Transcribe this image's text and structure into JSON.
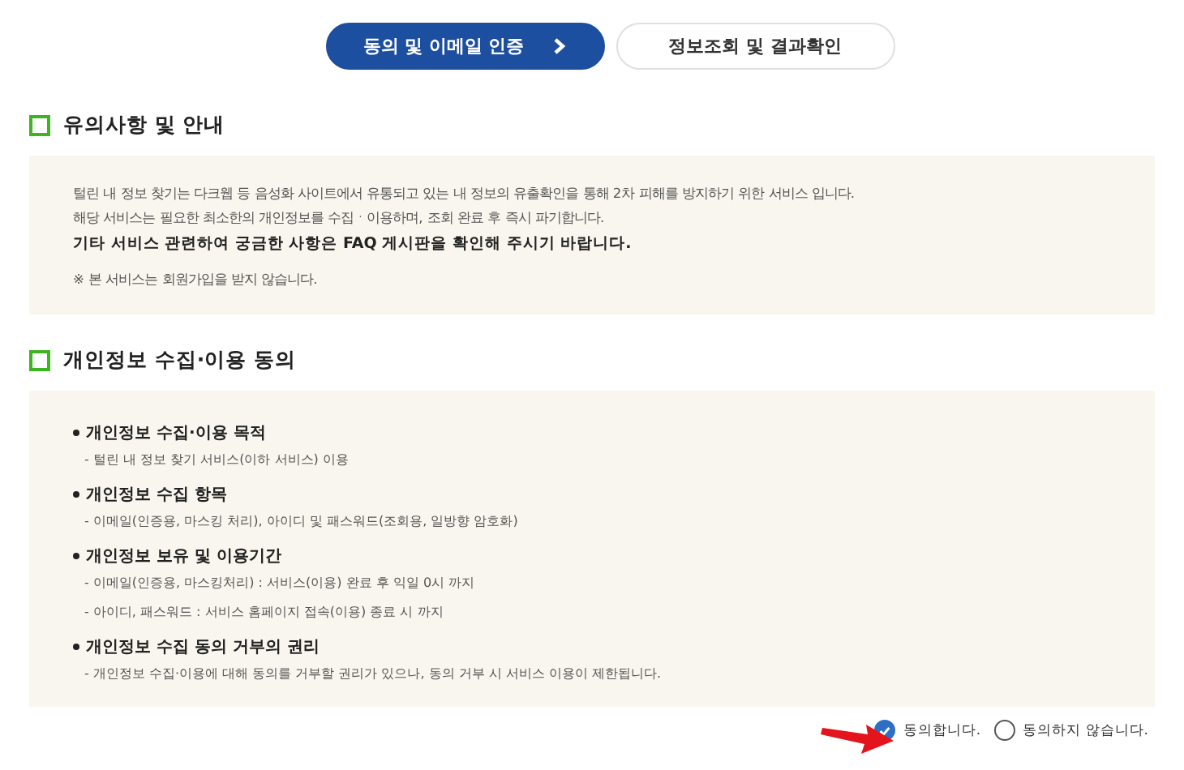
{
  "steps": [
    {
      "label": "동의 및 이메일 인증",
      "selected": true
    },
    {
      "label": "정보조회 및 결과확인",
      "selected": false
    }
  ],
  "notice": {
    "title": "유의사항 및 안내",
    "lines": [
      {
        "text": "털린 내 정보 찾기는 다크웹 등 음성화 사이트에서 유통되고 있는 내 정보의 유출확인을 통해 2차 피해를 방지하기 위한 서비스 입니다.",
        "kind": "plain"
      },
      {
        "text": "해당 서비스는 필요한 최소한의 개인정보를 수집ㆍ이용하며, 조회 완료 후 즉시 파기합니다.",
        "kind": "plain"
      },
      {
        "text": "기타 서비스 관련하여 궁금한 사항은 FAQ 게시판을 확인해 주시기 바랍니다.",
        "kind": "strong"
      },
      {
        "text": "※ 본 서비스는 회원가입을 받지 않습니다.",
        "kind": "note"
      }
    ]
  },
  "consent": {
    "title": "개인정보 수집·이용 동의",
    "items": [
      {
        "heading": "개인정보 수집·이용 목적",
        "details": [
          "- 털린 내 정보 찾기 서비스(이하 서비스) 이용"
        ]
      },
      {
        "heading": "개인정보 수집 항목",
        "details": [
          "- 이메일(인증용, 마스킹 처리), 아이디 및 패스워드(조회용, 일방향 암호화)"
        ]
      },
      {
        "heading": "개인정보 보유 및 이용기간",
        "details": [
          "- 이메일(인증용, 마스킹처리) : 서비스(이용) 완료 후 익일 0시 까지",
          "- 아이디, 패스워드 : 서비스 홈페이지 접속(이용) 종료 시 까지"
        ]
      },
      {
        "heading": "개인정보 수집 동의 거부의 권리",
        "details": [
          "- 개인정보 수집·이용에 대해 동의를 거부할 권리가 있으나, 동의 거부 시 서비스 이용이 제한됩니다."
        ]
      }
    ]
  },
  "choices": [
    {
      "label": "동의합니다.",
      "selected": true
    },
    {
      "label": "동의하지 않습니다.",
      "selected": false
    }
  ]
}
